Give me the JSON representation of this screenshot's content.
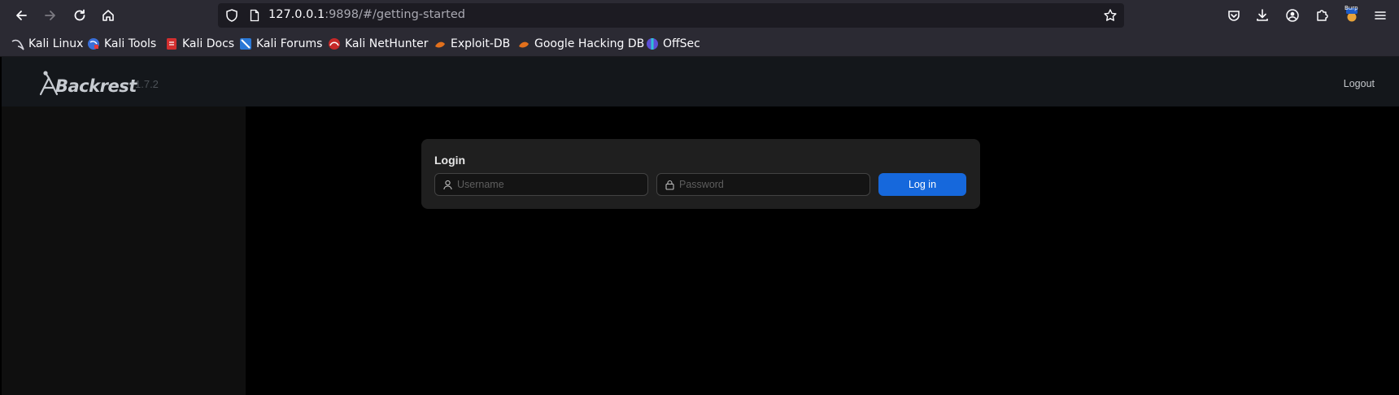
{
  "browser": {
    "url_host": "127.0.0.1",
    "url_rest": ":9898/#/getting-started",
    "bookmarks": [
      {
        "label": "Kali Linux",
        "icon": "kali-dragon-icon"
      },
      {
        "label": "Kali Tools",
        "icon": "kali-tools-icon"
      },
      {
        "label": "Kali Docs",
        "icon": "kali-docs-icon"
      },
      {
        "label": "Kali Forums",
        "icon": "kali-forums-icon"
      },
      {
        "label": "Kali NetHunter",
        "icon": "nethunter-icon"
      },
      {
        "label": "Exploit-DB",
        "icon": "exploit-db-icon"
      },
      {
        "label": "Google Hacking DB",
        "icon": "ghdb-icon"
      },
      {
        "label": "OffSec",
        "icon": "offsec-icon"
      }
    ],
    "extension_badge": "Burp"
  },
  "app": {
    "logo_text": "Backrest",
    "version": "1.7.2",
    "logout_label": "Logout"
  },
  "login": {
    "title": "Login",
    "username_placeholder": "Username",
    "password_placeholder": "Password",
    "button_label": "Log in"
  },
  "colors": {
    "accent": "#1668dc",
    "browser_chrome": "#2b2a33",
    "header_bg": "#14171b",
    "sidebar_bg": "#0f0f0f",
    "card_bg": "#1f1f1f"
  }
}
